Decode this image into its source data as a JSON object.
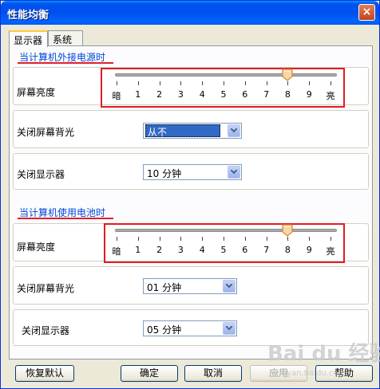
{
  "window": {
    "title": "性能均衡",
    "close_glyph": "×"
  },
  "tabs": [
    {
      "label": "显示器",
      "active": true
    },
    {
      "label": "系统",
      "active": false
    }
  ],
  "sections": [
    {
      "title": "当计算机外接电源时",
      "brightness_label": "屏幕亮度",
      "brightness_value": 8,
      "ticks": [
        "暗",
        "1",
        "2",
        "3",
        "4",
        "5",
        "6",
        "7",
        "8",
        "9",
        "亮"
      ],
      "backlight_label": "关闭屏幕背光",
      "backlight_value": "从不",
      "display_label": "关闭显示器",
      "display_value": "10 分钟"
    },
    {
      "title": "当计算机使用电池时",
      "brightness_label": "屏幕亮度",
      "brightness_value": 8,
      "ticks": [
        "暗",
        "1",
        "2",
        "3",
        "4",
        "5",
        "6",
        "7",
        "8",
        "9",
        "亮"
      ],
      "backlight_label": "关闭屏幕背光",
      "backlight_value": "01 分钟",
      "display_label": "关闭显示器",
      "display_value": "05 分钟"
    }
  ],
  "buttons": {
    "restore": "恢复默认",
    "ok": "确定",
    "cancel": "取消",
    "apply": "应用",
    "help": "帮助"
  },
  "watermark": {
    "text": "Bai du 经验",
    "sub": "jingyan.baidu.com"
  },
  "colors": {
    "accent_red": "#e01c24",
    "section_title": "#0046d5",
    "titlebar": "#0053ee"
  }
}
